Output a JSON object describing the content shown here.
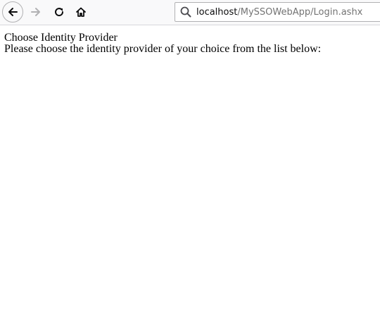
{
  "browser": {
    "icons": {
      "back": "back-arrow-icon",
      "forward": "forward-arrow-icon",
      "reload": "reload-icon",
      "home": "home-icon",
      "search": "search-icon"
    },
    "url": {
      "host": "localhost",
      "path": "/MySSOWebApp/Login.ashx"
    }
  },
  "page": {
    "heading": "Choose Identity Provider",
    "instructions": "Please choose the identity provider of your choice from the list below:"
  }
}
